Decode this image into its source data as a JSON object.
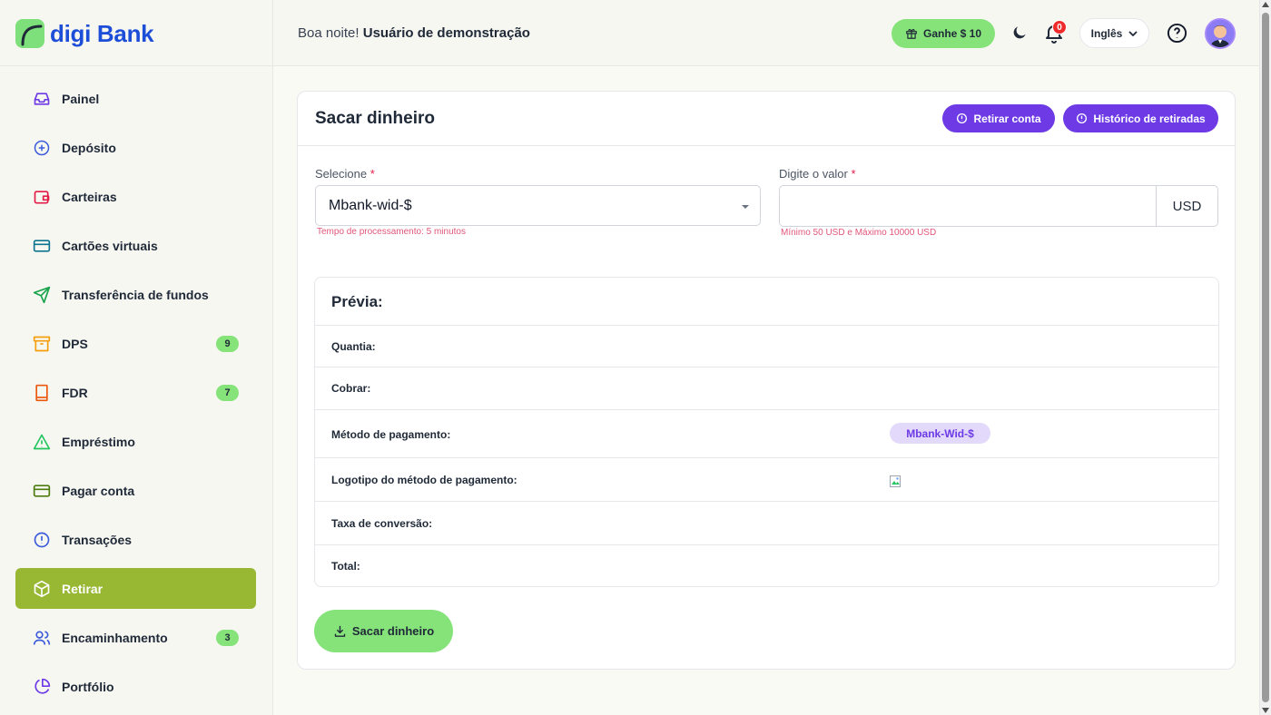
{
  "brand": {
    "name": "digi Bank",
    "accent": "#1d4ed8",
    "mark_color": "#7ee07a"
  },
  "header": {
    "greeting": "Boa noite!",
    "user_name": "Usuário de demonstração",
    "earn_label": "Ganhe $ 10",
    "notification_count": "0",
    "language": "Inglês"
  },
  "sidebar": {
    "items": [
      {
        "label": "Painel",
        "icon": "inbox-icon"
      },
      {
        "label": "Depósito",
        "icon": "plus-circle-icon"
      },
      {
        "label": "Carteiras",
        "icon": "wallet-icon"
      },
      {
        "label": "Cartões virtuais",
        "icon": "credit-card-icon"
      },
      {
        "label": "Transferência de fundos",
        "icon": "send-icon"
      },
      {
        "label": "DPS",
        "icon": "archive-icon",
        "badge": "9"
      },
      {
        "label": "FDR",
        "icon": "book-icon",
        "badge": "7"
      },
      {
        "label": "Empréstimo",
        "icon": "alert-triangle-icon"
      },
      {
        "label": "Pagar conta",
        "icon": "card-icon"
      },
      {
        "label": "Transações",
        "icon": "info-circle-icon"
      },
      {
        "label": "Retirar",
        "icon": "box-icon",
        "active": true
      },
      {
        "label": "Encaminhamento",
        "icon": "users-icon",
        "badge": "3"
      },
      {
        "label": "Portfólio",
        "icon": "pie-chart-icon"
      }
    ]
  },
  "main": {
    "title": "Sacar dinheiro",
    "buttons": {
      "withdraw_account": "Retirar conta",
      "withdraw_history": "Histórico de retiradas"
    },
    "form": {
      "select_label": "Selecione",
      "required_mark": "*",
      "select_value": "Mbank-wid-$",
      "processing_hint": "Tempo de processamento: 5 minutos",
      "amount_label": "Digite o valor",
      "amount_value": "",
      "amount_placeholder": "",
      "currency": "USD",
      "amount_hint": "Mínimo 50 USD e Máximo 10000 USD"
    },
    "preview": {
      "title": "Prévia:",
      "amount_label": "Quantia:",
      "charge_label": "Cobrar:",
      "method_label": "Método de pagamento:",
      "method_value": "Mbank-Wid-$",
      "logo_label": "Logotipo do método de pagamento:",
      "rate_label": "Taxa de conversão:",
      "total_label": "Total:"
    },
    "submit_label": "Sacar dinheiro"
  },
  "colors": {
    "active_nav": "#98b733",
    "primary_purple": "#6d3ae6",
    "green": "#86e37a",
    "hint_pink": "#e0567a"
  }
}
